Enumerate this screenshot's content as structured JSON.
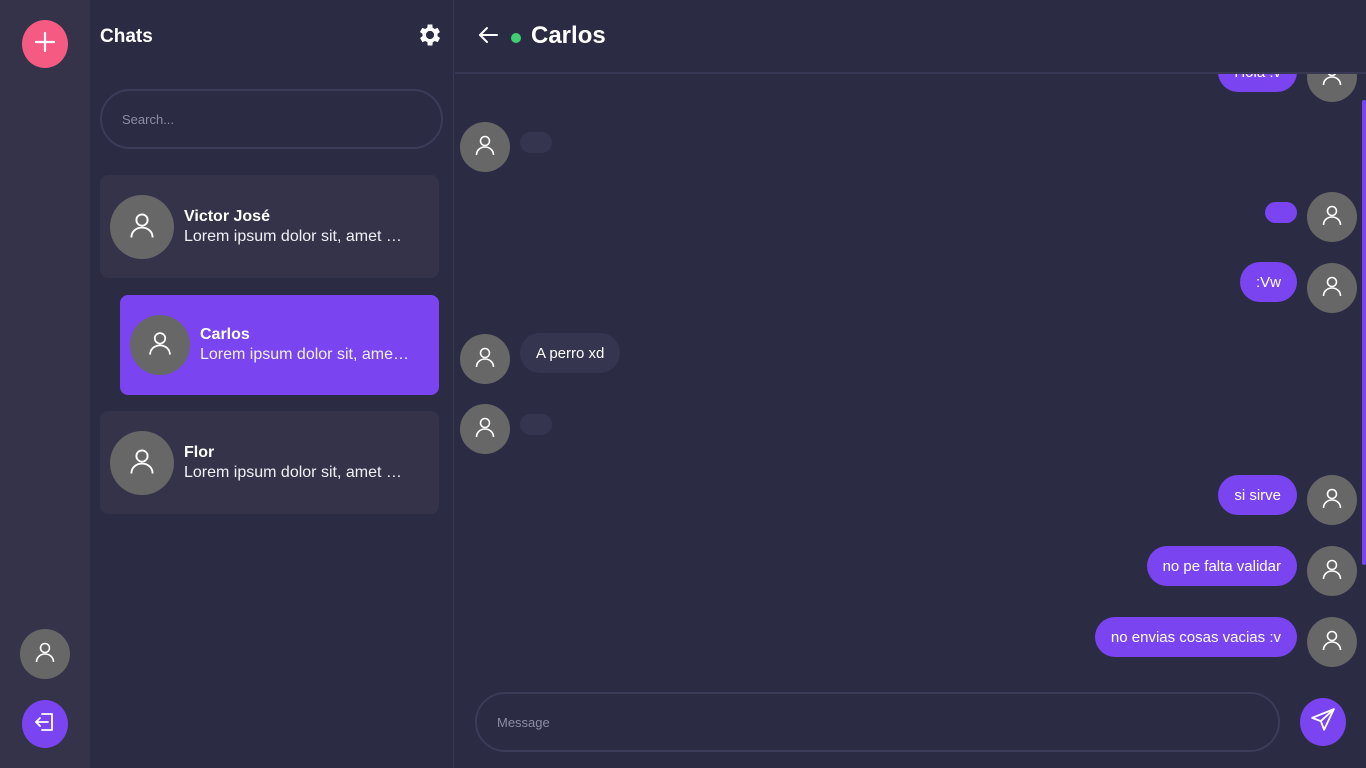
{
  "rail": {
    "add_icon": "plus-icon",
    "user_icon": "user-icon",
    "logout_icon": "logout-icon"
  },
  "chats": {
    "title": "Chats",
    "settings_icon": "gear-icon",
    "search_placeholder": "Search...",
    "items": [
      {
        "name": "Victor José",
        "preview": "Lorem ipsum dolor sit, amet consectetur",
        "active": false
      },
      {
        "name": "Carlos",
        "preview": "Lorem ipsum dolor sit, amet consectetur",
        "active": true
      },
      {
        "name": "Flor",
        "preview": "Lorem ipsum dolor sit, amet consectetur",
        "active": false
      }
    ]
  },
  "conversation": {
    "name": "Carlos",
    "status": "online",
    "message_placeholder": "Message",
    "messages": [
      {
        "direction": "out",
        "text": "Hola :v"
      },
      {
        "direction": "in",
        "text": ""
      },
      {
        "direction": "out",
        "text": ""
      },
      {
        "direction": "out",
        "text": ":Vw"
      },
      {
        "direction": "in",
        "text": "A perro xd"
      },
      {
        "direction": "in",
        "text": ""
      },
      {
        "direction": "out",
        "text": "si sirve"
      },
      {
        "direction": "out",
        "text": "no pe falta validar"
      },
      {
        "direction": "out",
        "text": "no envias cosas vacias :v"
      }
    ]
  },
  "colors": {
    "accent": "#7a44f0",
    "add_button": "#f45a82",
    "online": "#3ecf6e",
    "background": "#2b2b44",
    "panel": "#343349"
  }
}
